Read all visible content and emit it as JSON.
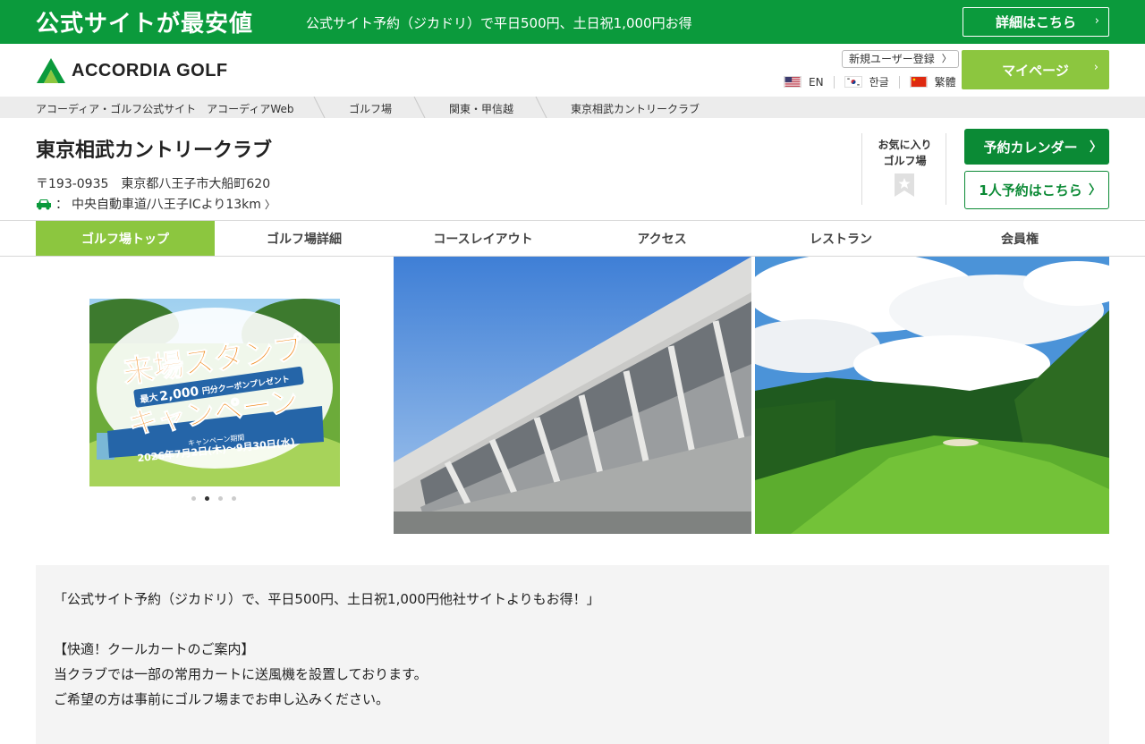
{
  "promo": {
    "headline": "公式サイトが最安値",
    "subtext": "公式サイト予約（ジカドリ）で平日500円、土日祝1,000円お得",
    "detail_label": "詳細はこちら",
    "chevron": "›"
  },
  "header": {
    "logo_text": "ACCORDIA GOLF",
    "signup_label": "新規ユーザー登録",
    "signup_chevron": "〉",
    "languages": [
      {
        "label": "EN",
        "flag": "us-flag-icon"
      },
      {
        "label": "한글",
        "flag": "kr-flag-icon"
      },
      {
        "label": "繁體",
        "flag": "cn-flag-icon"
      }
    ],
    "mypage_label": "マイページ",
    "mypage_chevron": "›"
  },
  "breadcrumb": [
    "アコーディア・ゴルフ公式サイト　アコーディアWeb",
    "ゴルフ場",
    "関東・甲信越",
    "東京相武カントリークラブ"
  ],
  "club": {
    "name": "東京相武カントリークラブ",
    "address": "〒193-0935　東京都八王子市大船町620",
    "access_prefix": "：",
    "access": "中央自動車道/八王子ICより13km",
    "access_chevron": "〉",
    "favorite_line1": "お気に入り",
    "favorite_line2": "ゴルフ場",
    "calendar_label": "予約カレンダー",
    "solo_label": "1人予約はこちら",
    "chevron": "〉"
  },
  "nav": {
    "tabs": [
      "ゴルフ場トップ",
      "ゴルフ場詳細",
      "コースレイアウト",
      "アクセス",
      "レストラン",
      "会員権"
    ],
    "active_index": 0
  },
  "campaign": {
    "title_line1": "来場スタンプ",
    "title_line2": "キャンペーン",
    "max_prefix": "最大",
    "amount": "2,000",
    "suffix": "円分クーポンプレゼント",
    "period_label": "キャンペーン期間",
    "period": "2026年7月2日(木)～9月30日(水)",
    "slides": 4,
    "active_slide": 1
  },
  "description": {
    "lines": [
      "「公式サイト予約（ジカドリ）で、平日500円、土日祝1,000円他社サイトよりもお得！」",
      "",
      "【快適！クールカートのご案内】",
      "当クラブでは一部の常用カートに送風機を設置しております。",
      "ご希望の方は事前にゴルフ場までお申し込みください。"
    ]
  },
  "colors": {
    "brand_green": "#0b9a3c",
    "light_green": "#8cc63f",
    "dark_green": "#0b8a35"
  }
}
